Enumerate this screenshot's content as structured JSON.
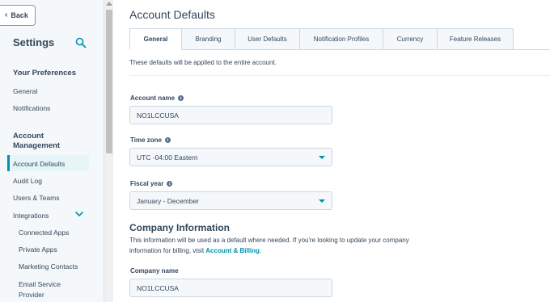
{
  "sidebar": {
    "back_label": "Back",
    "title": "Settings",
    "your_preferences": "Your Preferences",
    "pref_items": [
      "General",
      "Notifications"
    ],
    "account_management_line1": "Account",
    "account_management_line2": "Management",
    "account_items": {
      "account_defaults": "Account Defaults",
      "audit_log": "Audit Log",
      "users_teams": "Users & Teams",
      "integrations": "Integrations",
      "connected_apps": "Connected Apps",
      "private_apps": "Private Apps",
      "marketing_contacts": "Marketing Contacts",
      "email_service_line1": "Email Service",
      "email_service_line2": "Provider"
    }
  },
  "main": {
    "title": "Account Defaults",
    "tabs": [
      {
        "label": "General"
      },
      {
        "label": "Branding"
      },
      {
        "label": "User Defaults"
      },
      {
        "label": "Notification Profiles"
      },
      {
        "label": "Currency"
      },
      {
        "label": "Feature Releases"
      }
    ],
    "intro": "These defaults will be applied to the entire account.",
    "account_name": {
      "label": "Account name",
      "value": "NO1LCCUSA"
    },
    "time_zone": {
      "label": "Time zone",
      "value": "UTC -04:00 Eastern"
    },
    "fiscal_year": {
      "label": "Fiscal year",
      "value": "January - December"
    },
    "company": {
      "title": "Company Information",
      "desc_line1": "This information will be used as a default where needed. If you're looking to update your company",
      "desc_line2_prefix": "information for billing, visit ",
      "desc_link": "Account & Billing",
      "desc_line2_suffix": ".",
      "name_label": "Company name",
      "name_value": "NO1LCCUSA"
    }
  },
  "colors": {
    "accent": "#0091ae",
    "text": "#33475b",
    "sidebar_bg": "#f5f8fa",
    "active_bg": "#e5f5f8"
  }
}
